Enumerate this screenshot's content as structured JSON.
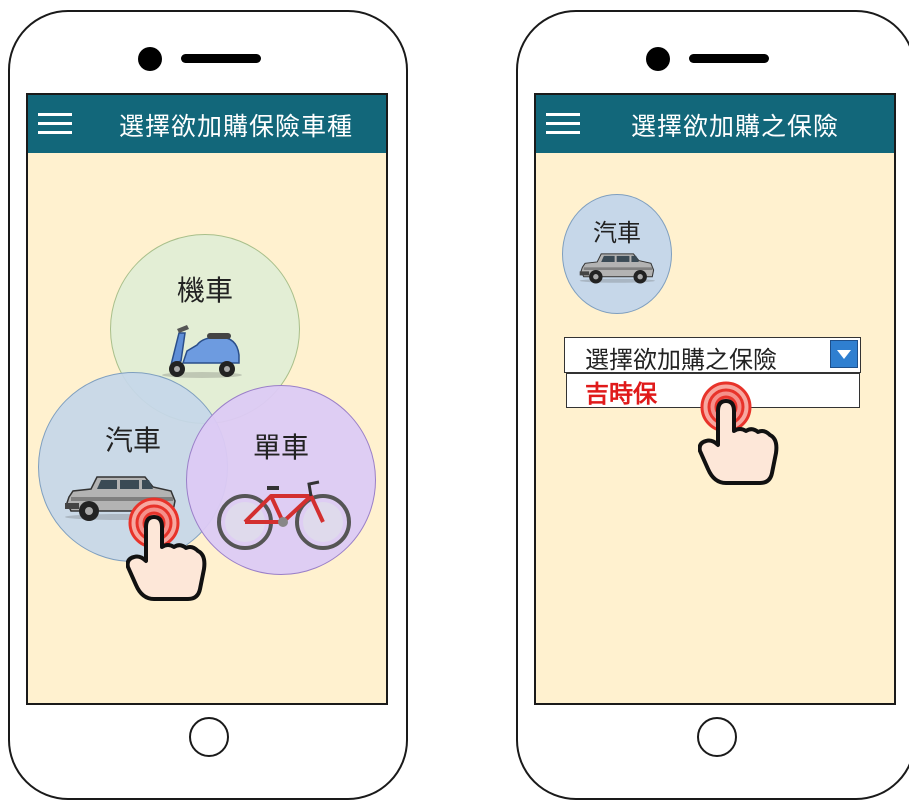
{
  "screen1": {
    "header": {
      "title": "選擇欲加購保險車種"
    },
    "options": [
      {
        "label": "機車",
        "icon": "scooter-icon",
        "color": "#e3eed5"
      },
      {
        "label": "汽車",
        "icon": "car-icon",
        "color": "#c6d7e9"
      },
      {
        "label": "單車",
        "icon": "bicycle-icon",
        "color": "#dccaf4"
      }
    ],
    "selected": "汽車"
  },
  "screen2": {
    "header": {
      "title": "選擇欲加購之保險"
    },
    "selected_vehicle": {
      "label": "汽車",
      "icon": "car-icon"
    },
    "dropdown": {
      "placeholder": "選擇欲加購之保險",
      "options": [
        "吉時保"
      ]
    }
  },
  "colors": {
    "appbar": "#12677a",
    "screen_bg": "#fff1cf",
    "option_text": "#e01a1a",
    "dropdown_button": "#2f7fd0"
  }
}
